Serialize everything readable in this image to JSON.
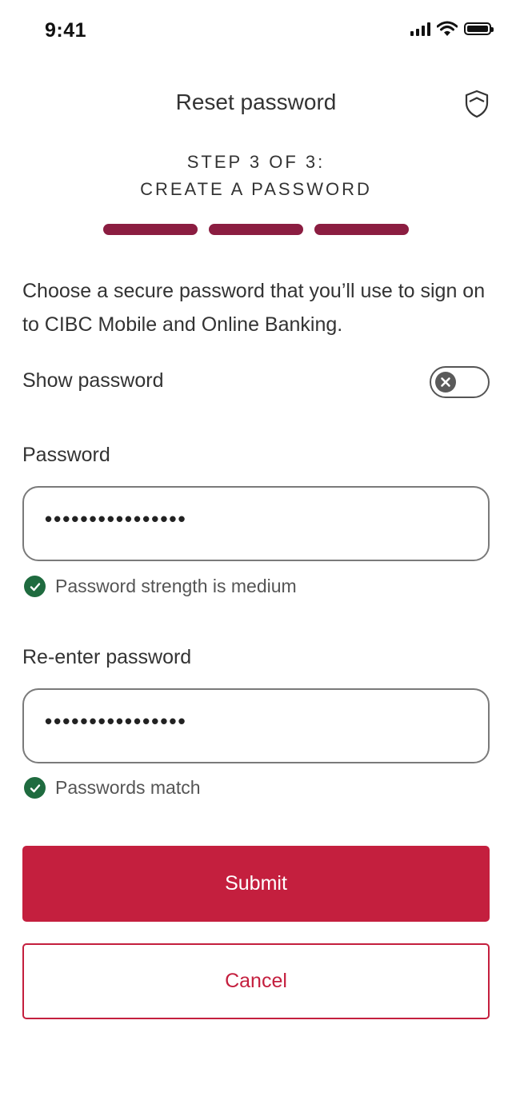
{
  "status_bar": {
    "time": "9:41",
    "icons": [
      "signal-icon",
      "wifi-icon",
      "battery-icon"
    ]
  },
  "header": {
    "title": "Reset password",
    "security_icon": "shield-icon"
  },
  "step": {
    "line1": "STEP 3 OF 3:",
    "line2": "CREATE A PASSWORD",
    "completed_steps": 3,
    "total_steps": 3
  },
  "description": "Choose a secure password that you’ll use to sign on to CIBC Mobile and Online Banking.",
  "show_password": {
    "label": "Show password",
    "enabled": false
  },
  "password": {
    "label": "Password",
    "value": "••••••••••••••••",
    "hint": "Password strength is medium"
  },
  "reenter_password": {
    "label": "Re-enter password",
    "value": "••••••••••••••••",
    "hint": "Passwords match"
  },
  "actions": {
    "submit_label": "Submit",
    "cancel_label": "Cancel"
  },
  "colors": {
    "brand_red": "#c41f3e",
    "progress": "#8b1d41",
    "success_green": "#1f6b3f"
  }
}
